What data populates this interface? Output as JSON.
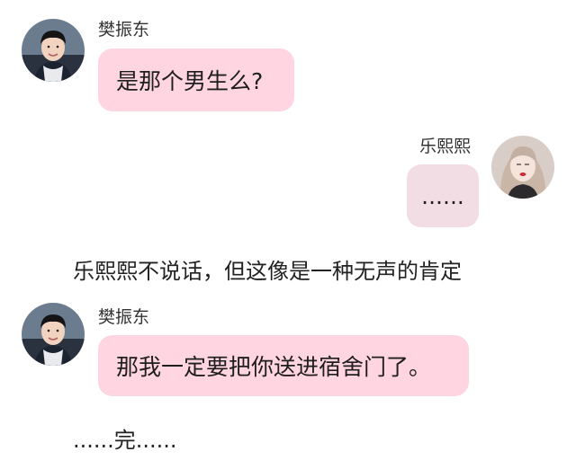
{
  "messages": [
    {
      "sender": "樊振东",
      "text": "是那个男生么?",
      "side": "left"
    },
    {
      "sender": "乐熙熙",
      "text": "......",
      "side": "right"
    },
    {
      "sender": "樊振东",
      "text": "那我一定要把你送进宿舍门了。",
      "side": "left"
    }
  ],
  "narration": {
    "line1": "乐熙熙不说话，但这像是一种无声的肯定",
    "line2": "......完......"
  },
  "colors": {
    "bubble_left": "#ffd5e1",
    "bubble_right": "#f3dde4",
    "background": "#ffffff"
  },
  "icons": {
    "avatar_left": "young-man-avatar",
    "avatar_right": "young-woman-avatar"
  }
}
